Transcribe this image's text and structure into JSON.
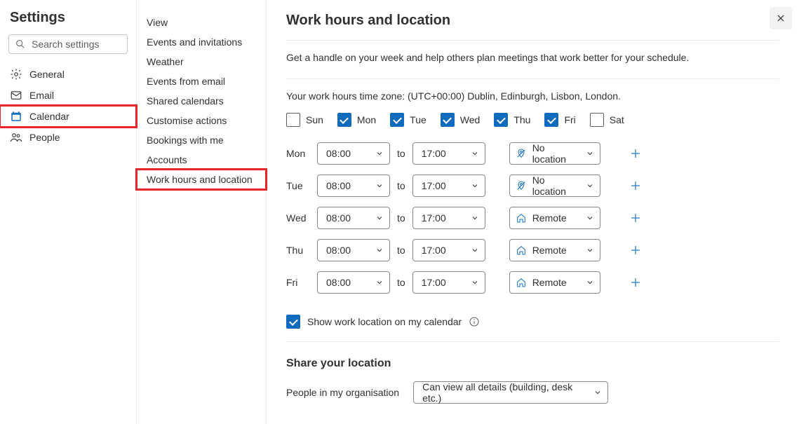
{
  "header": {
    "title": "Settings",
    "search_placeholder": "Search settings"
  },
  "nav": {
    "items": [
      {
        "label": "General"
      },
      {
        "label": "Email"
      },
      {
        "label": "Calendar"
      },
      {
        "label": "People"
      }
    ]
  },
  "subnav": {
    "items": [
      {
        "label": "View"
      },
      {
        "label": "Events and invitations"
      },
      {
        "label": "Weather"
      },
      {
        "label": "Events from email"
      },
      {
        "label": "Shared calendars"
      },
      {
        "label": "Customise actions"
      },
      {
        "label": "Bookings with me"
      },
      {
        "label": "Accounts"
      },
      {
        "label": "Work hours and location"
      }
    ]
  },
  "content": {
    "title": "Work hours and location",
    "description": "Get a handle on your week and help others plan meetings that work better for your schedule.",
    "timezone_line": "Your work hours time zone: (UTC+00:00) Dublin, Edinburgh, Lisbon, London.",
    "days": [
      {
        "label": "Sun",
        "checked": false
      },
      {
        "label": "Mon",
        "checked": true
      },
      {
        "label": "Tue",
        "checked": true
      },
      {
        "label": "Wed",
        "checked": true
      },
      {
        "label": "Thu",
        "checked": true
      },
      {
        "label": "Fri",
        "checked": true
      },
      {
        "label": "Sat",
        "checked": false
      }
    ],
    "to_label": "to",
    "schedule": [
      {
        "label": "Mon",
        "start": "08:00",
        "end": "17:00",
        "location": "No location",
        "loc_type": "none"
      },
      {
        "label": "Tue",
        "start": "08:00",
        "end": "17:00",
        "location": "No location",
        "loc_type": "none"
      },
      {
        "label": "Wed",
        "start": "08:00",
        "end": "17:00",
        "location": "Remote",
        "loc_type": "remote"
      },
      {
        "label": "Thu",
        "start": "08:00",
        "end": "17:00",
        "location": "Remote",
        "loc_type": "remote"
      },
      {
        "label": "Fri",
        "start": "08:00",
        "end": "17:00",
        "location": "Remote",
        "loc_type": "remote"
      }
    ],
    "show_location_label": "Show work location on my calendar",
    "show_location_checked": true,
    "share_heading": "Share your location",
    "share_label": "People in my organisation",
    "share_value": "Can view all details (building, desk etc.)"
  }
}
